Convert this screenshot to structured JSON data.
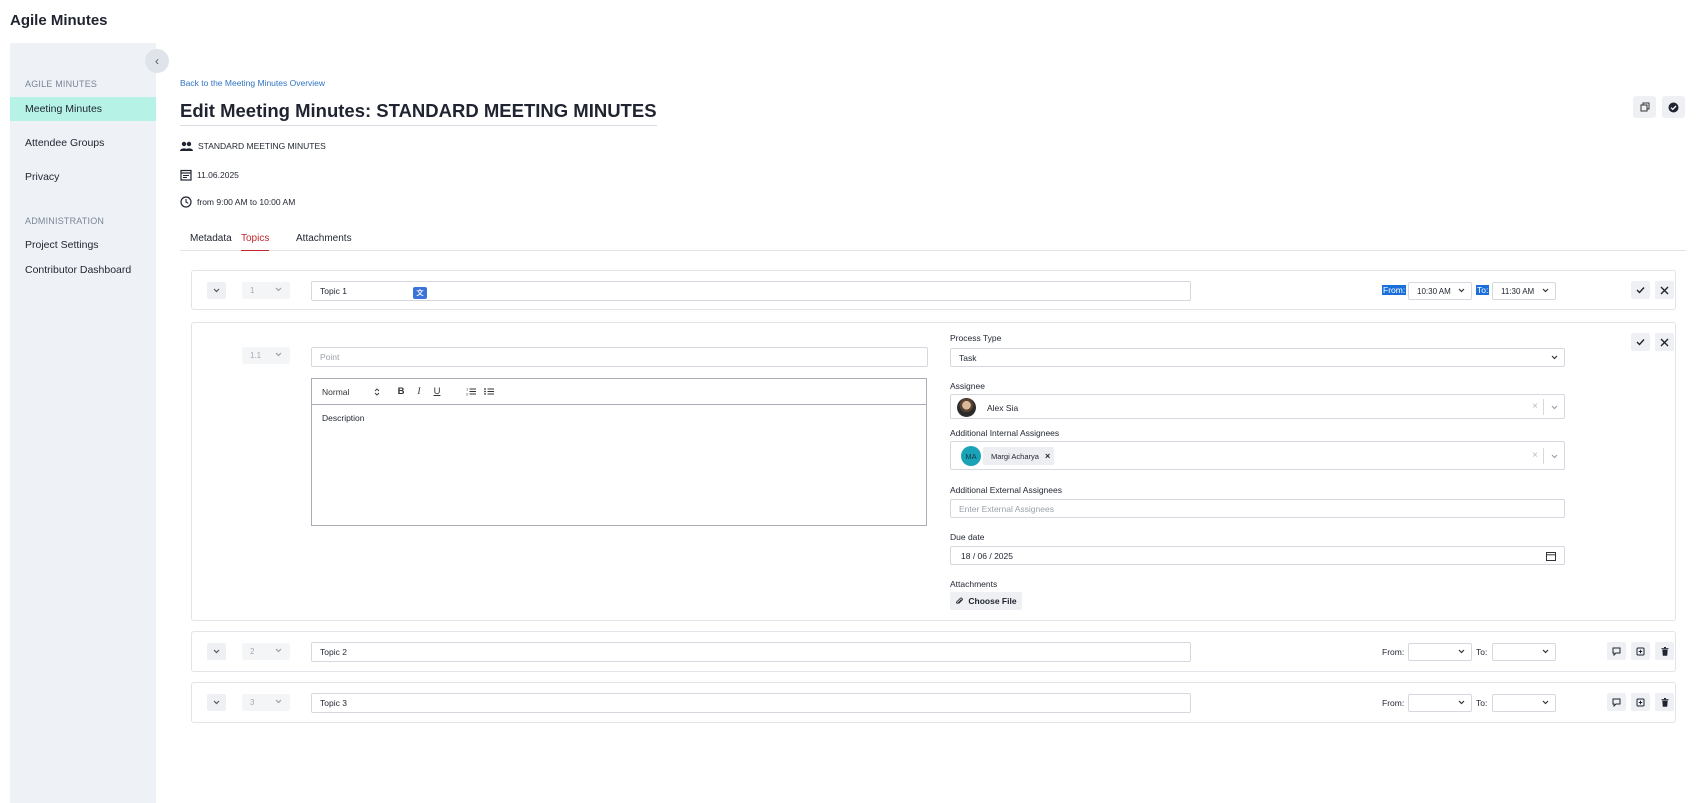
{
  "app": {
    "title": "Agile Minutes"
  },
  "sidebar": {
    "collapse_glyph": "‹",
    "sections": [
      {
        "label": "AGILE MINUTES"
      },
      {
        "label": "ADMINISTRATION"
      }
    ],
    "items": [
      {
        "label": "Meeting Minutes",
        "active": true
      },
      {
        "label": "Attendee Groups"
      },
      {
        "label": "Privacy"
      },
      {
        "label": "Project Settings"
      },
      {
        "label": "Contributor Dashboard"
      }
    ]
  },
  "header": {
    "back_link": "Back to the Meeting Minutes Overview",
    "title": "Edit Meeting Minutes: STANDARD MEETING MINUTES",
    "icons": [
      "copy-icon",
      "check-circle-icon"
    ]
  },
  "meta": {
    "group": "STANDARD MEETING MINUTES",
    "date": "11.06.2025",
    "time": "from 9:00 AM to 10:00 AM"
  },
  "tabs": [
    {
      "label": "Metadata"
    },
    {
      "label": "Topics",
      "active": true
    },
    {
      "label": "Attachments"
    }
  ],
  "topics": [
    {
      "number": "1",
      "title": "Topic 1",
      "from_label": "From:",
      "from": "10:30 AM",
      "to_label": "To:",
      "to": "11:30 AM",
      "editing": true
    },
    {
      "number": "2",
      "title": "Topic 2",
      "from_label": "From:",
      "from": "",
      "to_label": "To:",
      "to": ""
    },
    {
      "number": "3",
      "title": "Topic 3",
      "from_label": "From:",
      "from": "",
      "to_label": "To:",
      "to": ""
    }
  ],
  "point": {
    "number": "1.1",
    "title_placeholder": "Point",
    "editor": {
      "format": "Normal",
      "bold": "B",
      "italic": "I",
      "underline": "U",
      "description": "Description"
    },
    "process_type": {
      "label": "Process Type",
      "value": "Task"
    },
    "assignee": {
      "label": "Assignee",
      "value": "Alex Sia"
    },
    "additional_internal": {
      "label": "Additional Internal Assignees",
      "initials": "MA",
      "chip": "Margi Acharya",
      "chip_remove": "×"
    },
    "additional_external": {
      "label": "Additional External Assignees",
      "placeholder": "Enter External Assignees"
    },
    "due_date": {
      "label": "Due date",
      "value": "18 / 06 / 2025"
    },
    "attachments": {
      "label": "Attachments",
      "button": "Choose File"
    },
    "clear_glyph": "×"
  },
  "colors": {
    "accent_red": "#c7262f",
    "active_sidebar": "#b6f2e6",
    "link_blue": "#2f74c0",
    "selection_blue": "#1a6fdb"
  }
}
